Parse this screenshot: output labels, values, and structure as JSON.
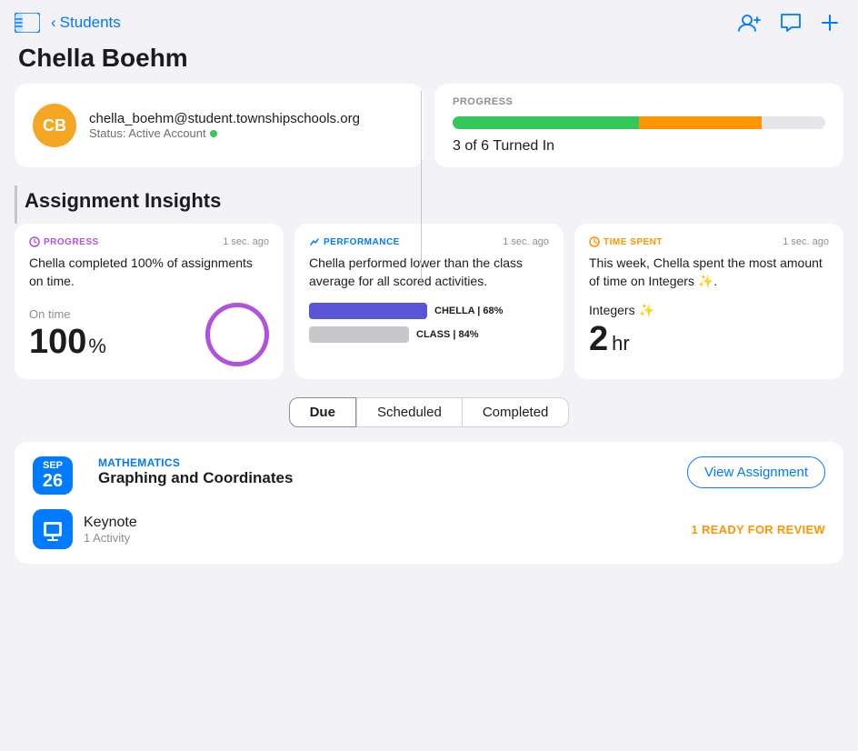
{
  "app": {
    "background": "#000000"
  },
  "topbar": {
    "back_label": "Students",
    "sidebar_icon": "sidebar-icon",
    "add_icon": "plus-icon",
    "chat_icon": "chat-icon",
    "person_icon": "person-add-icon"
  },
  "student": {
    "name": "Chella Boehm",
    "email": "chella_boehm@student.townshipschools.org",
    "status": "Status: Active Account",
    "avatar_initials": "CB"
  },
  "progress_card": {
    "label": "PROGRESS",
    "turned_in": "3 of 6 Turned In",
    "green_pct": 50,
    "orange_pct": 33
  },
  "insights": {
    "section_title": "Assignment Insights",
    "cards": [
      {
        "badge": "PROGRESS",
        "badge_class": "badge-purple",
        "time": "1 sec. ago",
        "description": "Chella completed 100% of assignments on time.",
        "metric_label": "On time",
        "metric_value": "100",
        "metric_unit": "%"
      },
      {
        "badge": "PERFORMANCE",
        "badge_class": "badge-blue",
        "time": "1 sec. ago",
        "description": "Chella performed lower than the class average for all scored activities.",
        "chella_pct": 68,
        "class_pct": 84,
        "chella_label": "CHELLA | 68%",
        "class_label": "CLASS | 84%"
      },
      {
        "badge": "TIME SPENT",
        "badge_class": "badge-orange",
        "time": "1 sec. ago",
        "description": "This week, Chella spent the most amount of time on Integers ✨.",
        "topic": "Integers ✨",
        "hours": "2",
        "hours_unit": "hr"
      }
    ]
  },
  "filter_tabs": {
    "tabs": [
      "Due",
      "Scheduled",
      "Completed"
    ],
    "active": "Due"
  },
  "assignments": [
    {
      "month": "SEP",
      "day": "26",
      "subject": "MATHEMATICS",
      "title": "Graphing and Coordinates",
      "view_btn": "View Assignment",
      "activity_icon": "📋",
      "activity_name": "Keynote",
      "activity_sub": "1 Activity",
      "activity_badge": "1 READY FOR REVIEW"
    }
  ]
}
